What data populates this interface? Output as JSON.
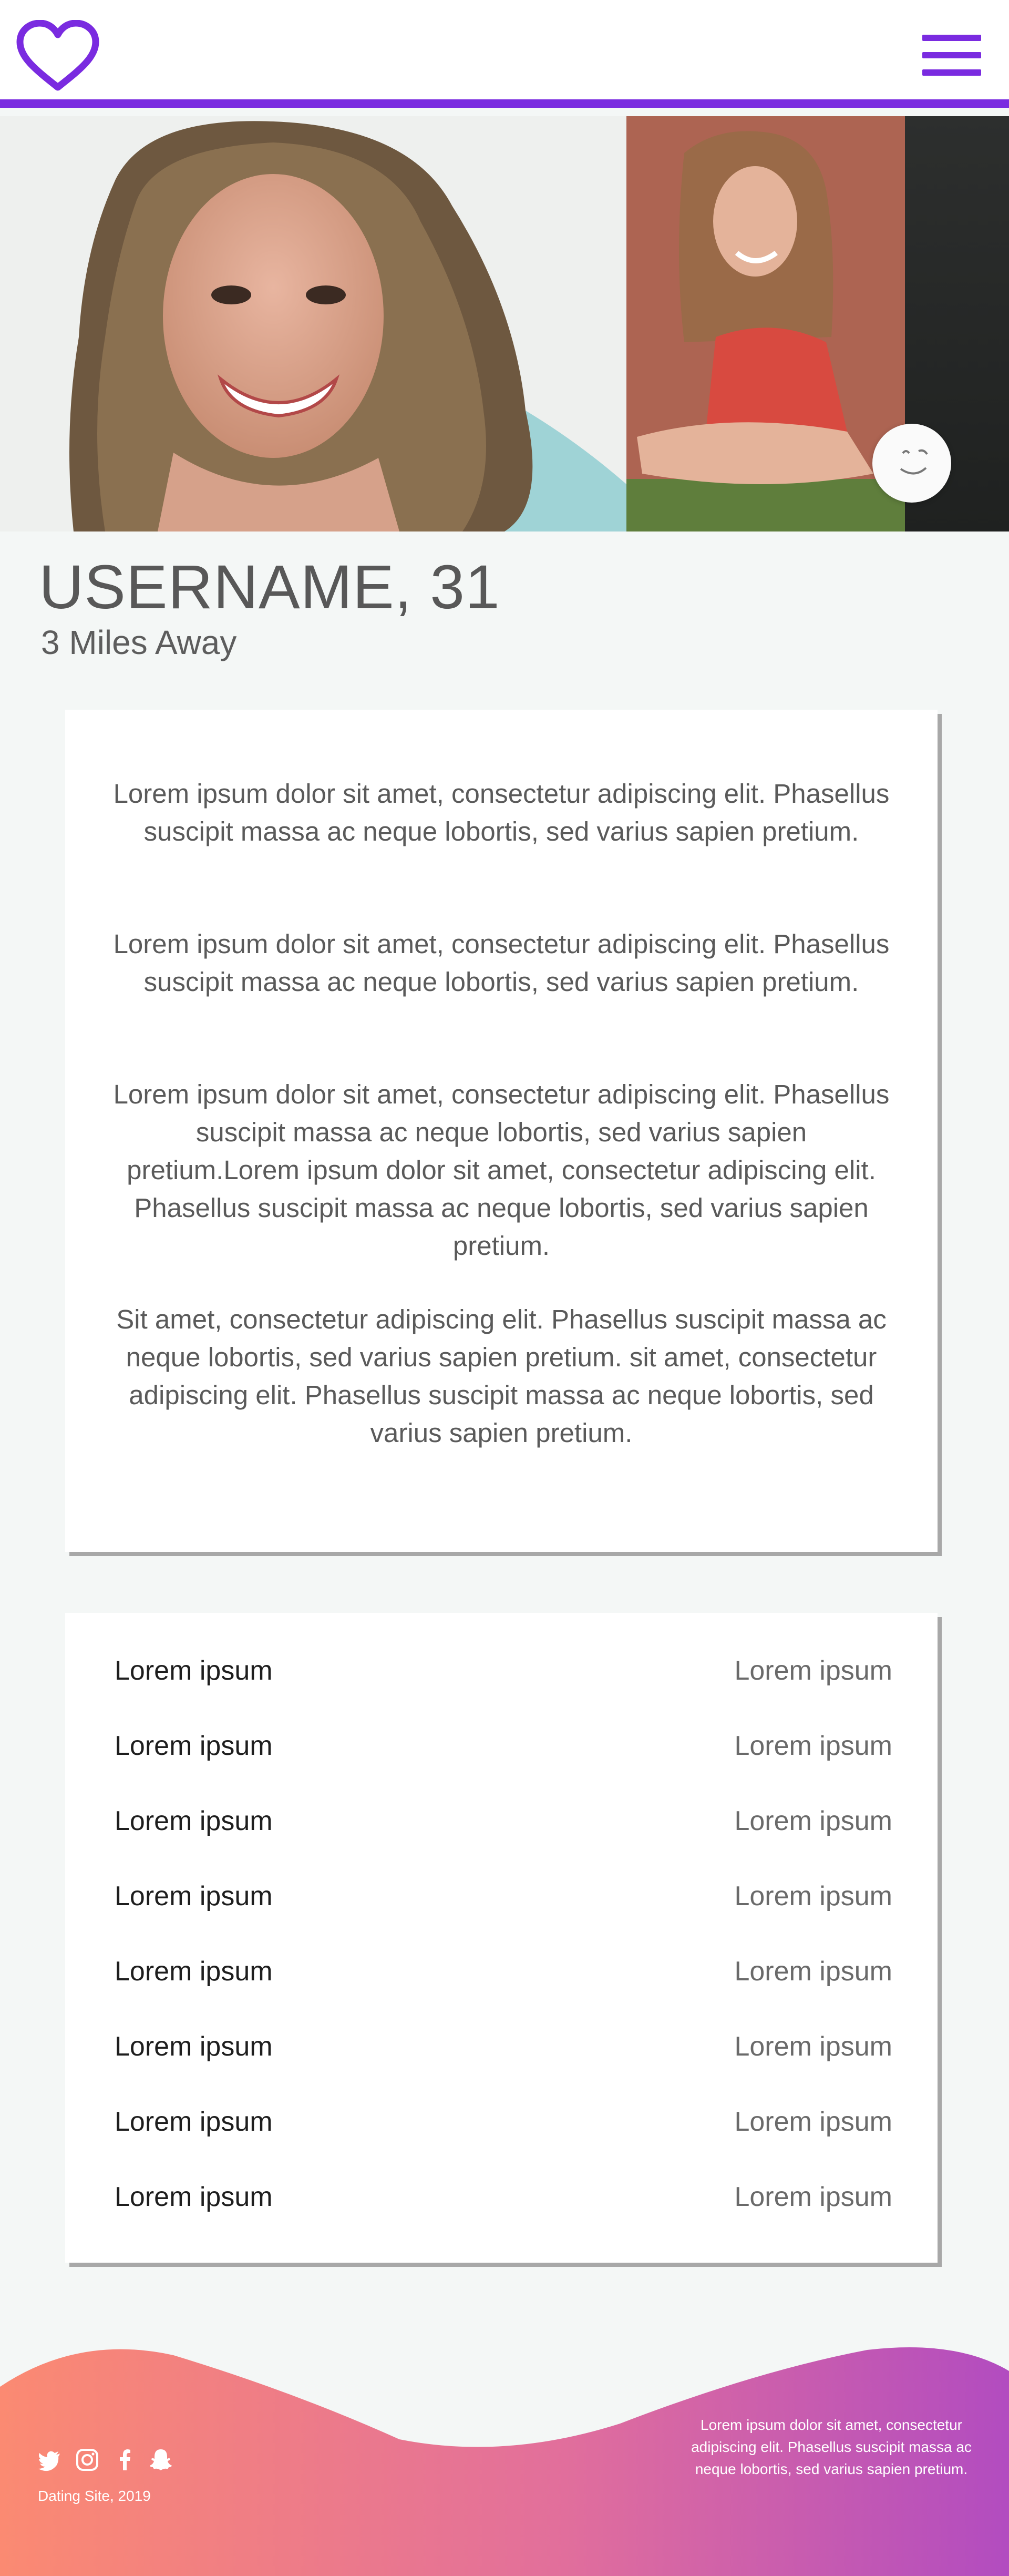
{
  "header": {
    "logo_icon": "heart-outline-icon",
    "menu_icon": "hamburger-menu-icon",
    "accent_color": "#7a2be0"
  },
  "photos": {
    "wink_icon": "wink-face-icon"
  },
  "profile": {
    "name_age": "USERNAME, 31",
    "distance": "3 Miles Away"
  },
  "about": {
    "paragraphs": [
      "Lorem ipsum dolor sit amet, consectetur adipiscing elit. Phasellus suscipit massa ac neque lobortis, sed varius sapien pretium.",
      "Lorem ipsum dolor sit amet, consectetur adipiscing elit. Phasellus suscipit massa ac neque lobortis, sed varius sapien pretium.",
      "Lorem ipsum dolor sit amet, consectetur adipiscing elit. Phasellus suscipit massa ac neque lobortis, sed varius sapien pretium.Lorem ipsum dolor sit amet, consectetur adipiscing elit. Phasellus suscipit massa ac neque lobortis, sed varius sapien pretium.",
      "Sit amet, consectetur adipiscing elit. Phasellus suscipit massa ac neque lobortis, sed varius sapien pretium. sit amet, consectetur adipiscing elit. Phasellus suscipit massa ac neque lobortis, sed varius sapien pretium."
    ]
  },
  "details": {
    "rows": [
      {
        "label": "Lorem ipsum",
        "value": "Lorem ipsum"
      },
      {
        "label": "Lorem ipsum",
        "value": "Lorem ipsum"
      },
      {
        "label": "Lorem ipsum",
        "value": "Lorem ipsum"
      },
      {
        "label": "Lorem ipsum",
        "value": "Lorem ipsum"
      },
      {
        "label": "Lorem ipsum",
        "value": "Lorem ipsum"
      },
      {
        "label": "Lorem ipsum",
        "value": "Lorem ipsum"
      },
      {
        "label": "Lorem ipsum",
        "value": "Lorem ipsum"
      },
      {
        "label": "Lorem ipsum",
        "value": "Lorem ipsum"
      }
    ]
  },
  "footer": {
    "social_icons": [
      "twitter-icon",
      "instagram-icon",
      "facebook-icon",
      "snapchat-icon"
    ],
    "copyright": "Dating Site, 2019",
    "blurb": "Lorem ipsum dolor sit amet, consectetur adipiscing elit. Phasellus suscipit massa ac neque lobortis, sed varius sapien pretium.",
    "gradient_start": "#fb8a72",
    "gradient_end": "#b24cc0"
  }
}
